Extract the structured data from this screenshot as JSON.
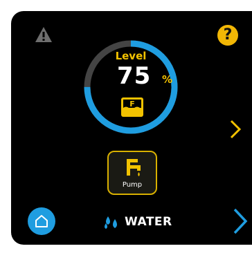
{
  "icons": {
    "warning": "warning-triangle-icon",
    "help": "help-icon",
    "tank": "tank-icon",
    "pump": "faucet-icon",
    "home": "home-icon",
    "drops": "water-drops-icon",
    "next": "chevron-right-icon"
  },
  "help": {
    "glyph": "?"
  },
  "level": {
    "label": "Level",
    "value": "75",
    "unit": "%",
    "fraction": 0.75,
    "tank_letter": "F"
  },
  "pump": {
    "label": "Pump"
  },
  "footer": {
    "title": "WATER"
  },
  "colors": {
    "accent_blue": "#1f9de0",
    "accent_yellow": "#f2c200",
    "track_gray": "#444444",
    "background": "#000000"
  }
}
